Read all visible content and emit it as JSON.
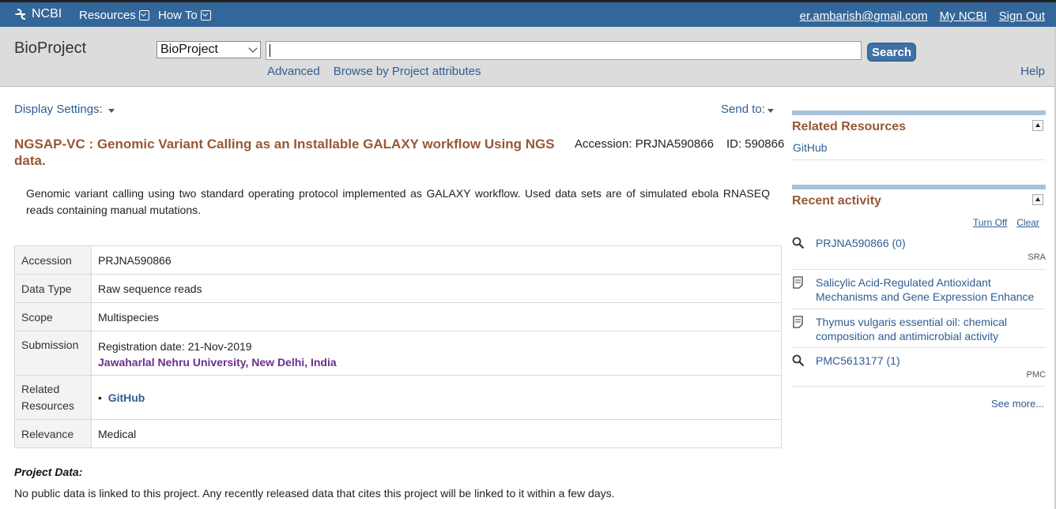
{
  "topbar": {
    "logo": "NCBI",
    "menu": [
      "Resources",
      "How To"
    ],
    "user_email": "er.ambarish@gmail.com",
    "my_ncbi": "My NCBI",
    "sign_out": "Sign Out"
  },
  "search": {
    "db_title": "BioProject",
    "db_selected": "BioProject",
    "query": "",
    "button": "Search",
    "advanced": "Advanced",
    "browse": "Browse by Project attributes",
    "help": "Help"
  },
  "controls": {
    "display_settings": "Display Settings:",
    "send_to": "Send to:"
  },
  "project": {
    "title": "NGSAP-VC : Genomic Variant Calling as an Installable GALAXY workflow Using NGS data.",
    "accession_label": "Accession: PRJNA590866",
    "id_label": "ID: 590866",
    "description": "Genomic variant calling using two standard operating protocol implemented as GALAXY workflow. Used data sets are of simulated ebola RNASEQ reads containing manual mutations.",
    "details": {
      "accession": {
        "label": "Accession",
        "value": "PRJNA590866"
      },
      "data_type": {
        "label": "Data Type",
        "value": "Raw sequence reads"
      },
      "scope": {
        "label": "Scope",
        "value": "Multispecies"
      },
      "submission": {
        "label": "Submission",
        "value": "Registration date: 21-Nov-2019",
        "org": "Jawaharlal Nehru University, New Delhi, India"
      },
      "related": {
        "label": "Related Resources",
        "value": "GitHub"
      },
      "relevance": {
        "label": "Relevance",
        "value": "Medical"
      }
    },
    "project_data_heading": "Project Data:",
    "project_data_text": "No public data is linked to this project. Any recently released data that cites this project will be linked to it within a few days."
  },
  "sidebar": {
    "related_resources": {
      "title": "Related Resources",
      "items": [
        "GitHub"
      ]
    },
    "recent_activity": {
      "title": "Recent activity",
      "turn_off": "Turn Off",
      "clear": "Clear",
      "items": [
        {
          "icon": "search-icon",
          "text": "PRJNA590866 (0)",
          "db": "SRA"
        },
        {
          "icon": "document-icon",
          "text_line1": "Salicylic Acid-Regulated Antioxidant",
          "text_line2": "Mechanisms and Gene Expression Enhance"
        },
        {
          "icon": "document-icon",
          "text_line1": "Thymus vulgaris essential oil: chemical",
          "text_line2": "composition and antimicrobial activity"
        },
        {
          "icon": "search-icon",
          "text": "PMC5613177 (1)",
          "db": "PMC"
        }
      ],
      "see_more": "See more..."
    }
  }
}
